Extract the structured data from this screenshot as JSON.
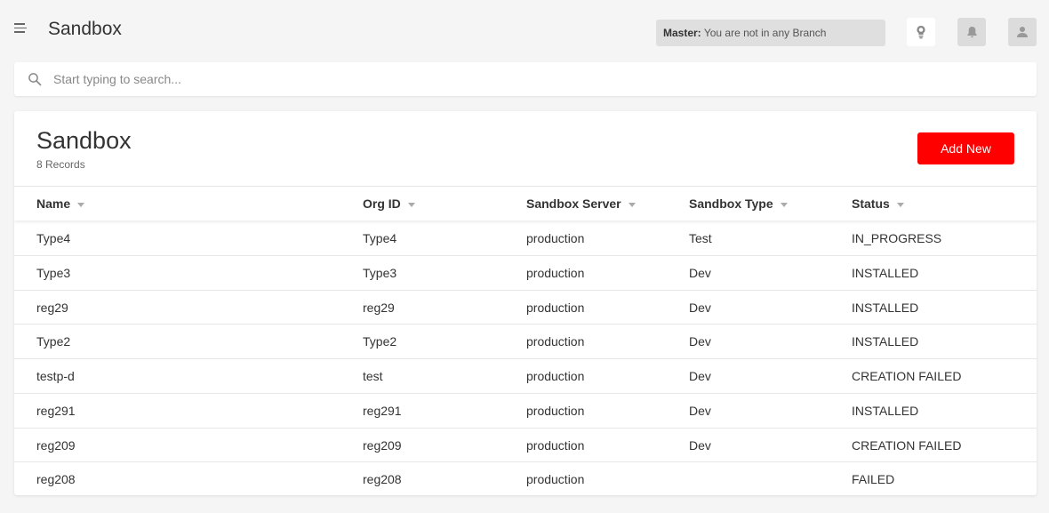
{
  "header": {
    "title": "Sandbox",
    "branch_label": "Master:",
    "branch_text": "You are not in any Branch",
    "icons": [
      "menu-icon",
      "lightbulb-icon",
      "bell-icon",
      "user-icon"
    ]
  },
  "search": {
    "placeholder": "Start typing to search...",
    "value": ""
  },
  "card": {
    "title": "Sandbox",
    "count": "8 Records",
    "add_label": "Add New",
    "accent_color": "#ff0000"
  },
  "table": {
    "columns": [
      "Name",
      "Org ID",
      "Sandbox Server",
      "Sandbox Type",
      "Status"
    ],
    "rows": [
      [
        "Type4",
        "Type4",
        "production",
        "Test",
        "IN_PROGRESS"
      ],
      [
        "Type3",
        "Type3",
        "production",
        "Dev",
        "INSTALLED"
      ],
      [
        "reg29",
        "reg29",
        "production",
        "Dev",
        "INSTALLED"
      ],
      [
        "Type2",
        "Type2",
        "production",
        "Dev",
        "INSTALLED"
      ],
      [
        "testp-d",
        "test",
        "production",
        "Dev",
        "CREATION FAILED"
      ],
      [
        "reg291",
        "reg291",
        "production",
        "Dev",
        "INSTALLED"
      ],
      [
        "reg209",
        "reg209",
        "production",
        "Dev",
        "CREATION FAILED"
      ],
      [
        "reg208",
        "reg208",
        "production",
        "",
        "FAILED"
      ]
    ]
  }
}
